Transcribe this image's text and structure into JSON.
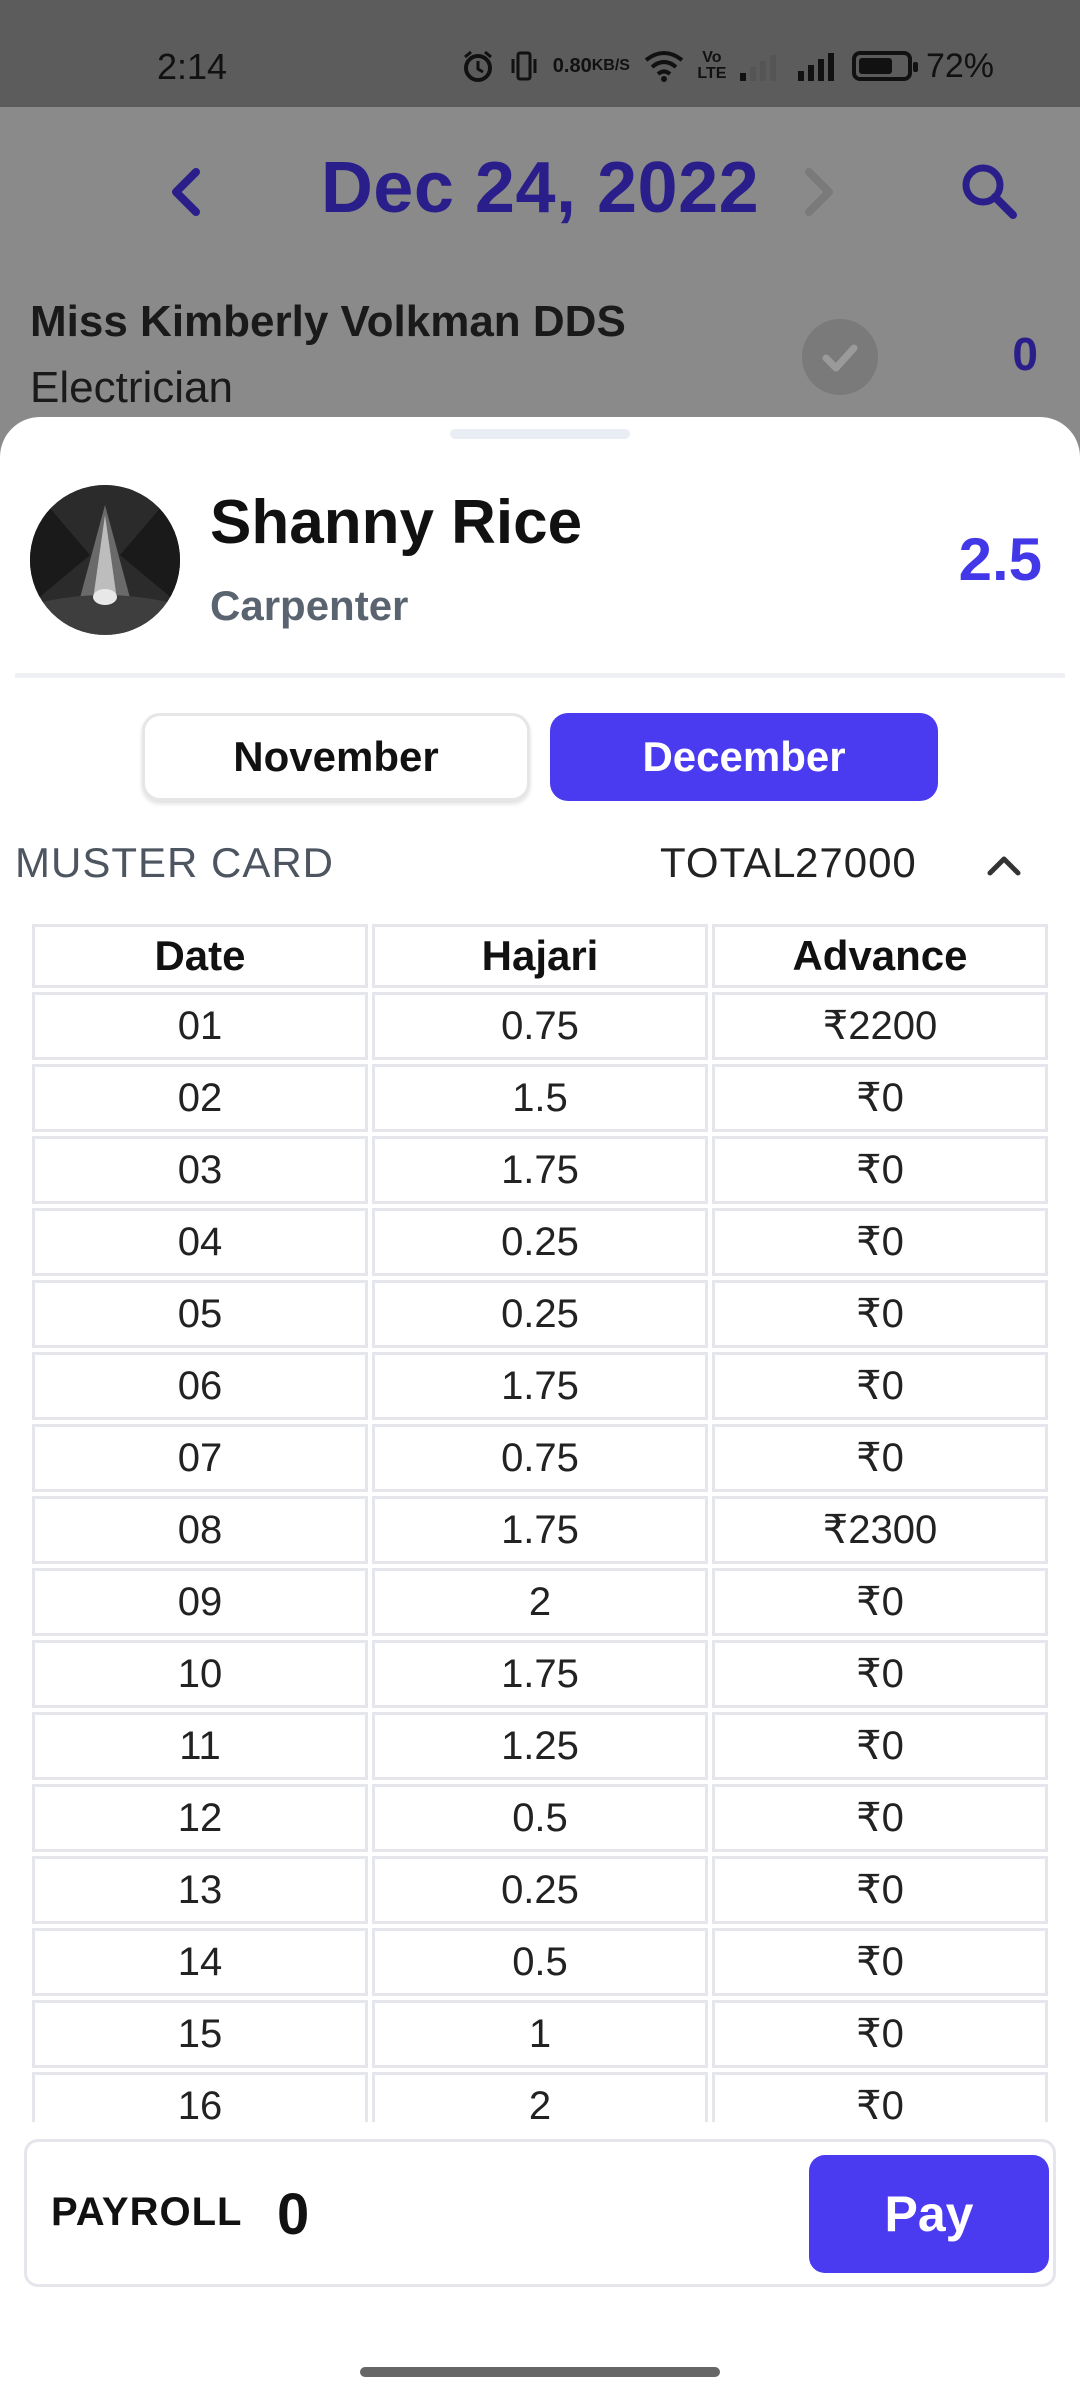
{
  "status_bar": {
    "time": "2:14",
    "net_speed_value": "0.80",
    "net_speed_unit": "KB/S",
    "volte_label": "Vo LTE",
    "battery_percent": "72%",
    "battery_level": 0.72,
    "icons": [
      "alarm-icon",
      "vibrate-icon",
      "wifi-icon",
      "volte-icon",
      "signal-icon",
      "signal-icon",
      "battery-icon"
    ]
  },
  "date_nav": {
    "title": "Dec 24, 2022",
    "prev_icon": "chevron-left-icon",
    "next_icon": "chevron-right-icon",
    "search_icon": "search-icon"
  },
  "background_worker": {
    "name": "Miss Kimberly Volkman DDS",
    "role": "Electrician",
    "count": "0"
  },
  "sheet": {
    "worker": {
      "name": "Shanny Rice",
      "role": "Carpenter",
      "score": "2.5"
    },
    "tabs": [
      {
        "label": "November",
        "active": false
      },
      {
        "label": "December",
        "active": true
      }
    ],
    "muster": {
      "title": "MUSTER CARD",
      "total_label": "TOTAL",
      "total_value": "27000",
      "columns": [
        "Date",
        "Hajari",
        "Advance"
      ],
      "rows": [
        [
          "01",
          "0.75",
          "₹2200"
        ],
        [
          "02",
          "1.5",
          "₹0"
        ],
        [
          "03",
          "1.75",
          "₹0"
        ],
        [
          "04",
          "0.25",
          "₹0"
        ],
        [
          "05",
          "0.25",
          "₹0"
        ],
        [
          "06",
          "1.75",
          "₹0"
        ],
        [
          "07",
          "0.75",
          "₹0"
        ],
        [
          "08",
          "1.75",
          "₹2300"
        ],
        [
          "09",
          "2",
          "₹0"
        ],
        [
          "10",
          "1.75",
          "₹0"
        ],
        [
          "11",
          "1.25",
          "₹0"
        ],
        [
          "12",
          "0.5",
          "₹0"
        ],
        [
          "13",
          "0.25",
          "₹0"
        ],
        [
          "14",
          "0.5",
          "₹0"
        ],
        [
          "15",
          "1",
          "₹0"
        ],
        [
          "16",
          "2",
          "₹0"
        ]
      ]
    },
    "payroll": {
      "label": "PAYROLL",
      "value": "0",
      "pay_label": "Pay"
    }
  },
  "colors": {
    "accent": "#4a3af0",
    "nav_title": "#2a1f8a",
    "score": "#4338e8"
  }
}
